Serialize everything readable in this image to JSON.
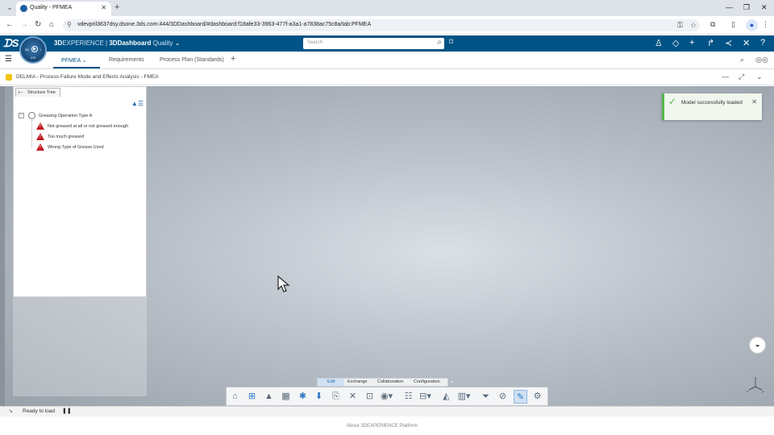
{
  "browser": {
    "tab_title": "Quality - PFMEA",
    "url": "vdevpril3637dsy.dsone.3ds.com:444/3DDashboard/#dashboard:f18afe33-3963-477f-a3a1-a7838ac75c8a/tab:PFMEA"
  },
  "header": {
    "brand_3d": "3D",
    "brand_experience": "EXPERIENCE",
    "brand_sep": " | ",
    "brand_app": "3DDashboard",
    "brand_context": "Quality",
    "compass_left": "3D",
    "compass_right": "i",
    "compass_bottom": "V.R",
    "search_placeholder": "Search"
  },
  "dashboard_tabs": [
    {
      "label": "PFMEA"
    },
    {
      "label": "Requirements"
    },
    {
      "label": "Process Plan (Standards)"
    }
  ],
  "app": {
    "title": "DELMIA - Process Failure Mode and Effects Analysis - FMEA"
  },
  "tree": {
    "tab_label": "Structure Tree",
    "root": "Greasing Operation Type A",
    "children": [
      {
        "label": "Not greased at all or not greased enough"
      },
      {
        "label": "Too much greased"
      },
      {
        "label": "Wrong Type of Grease Used"
      }
    ]
  },
  "toast": {
    "message": "Model successfully loaded"
  },
  "action_tabs": [
    {
      "label": "Edit"
    },
    {
      "label": "Exchange"
    },
    {
      "label": "Collaboration"
    },
    {
      "label": "Configuration"
    }
  ],
  "axis": {
    "x": "x",
    "y": "y",
    "z": "z"
  },
  "status": {
    "text": "Ready to load"
  },
  "footer": {
    "about": "About 3DEXPERIENCE Platform"
  }
}
